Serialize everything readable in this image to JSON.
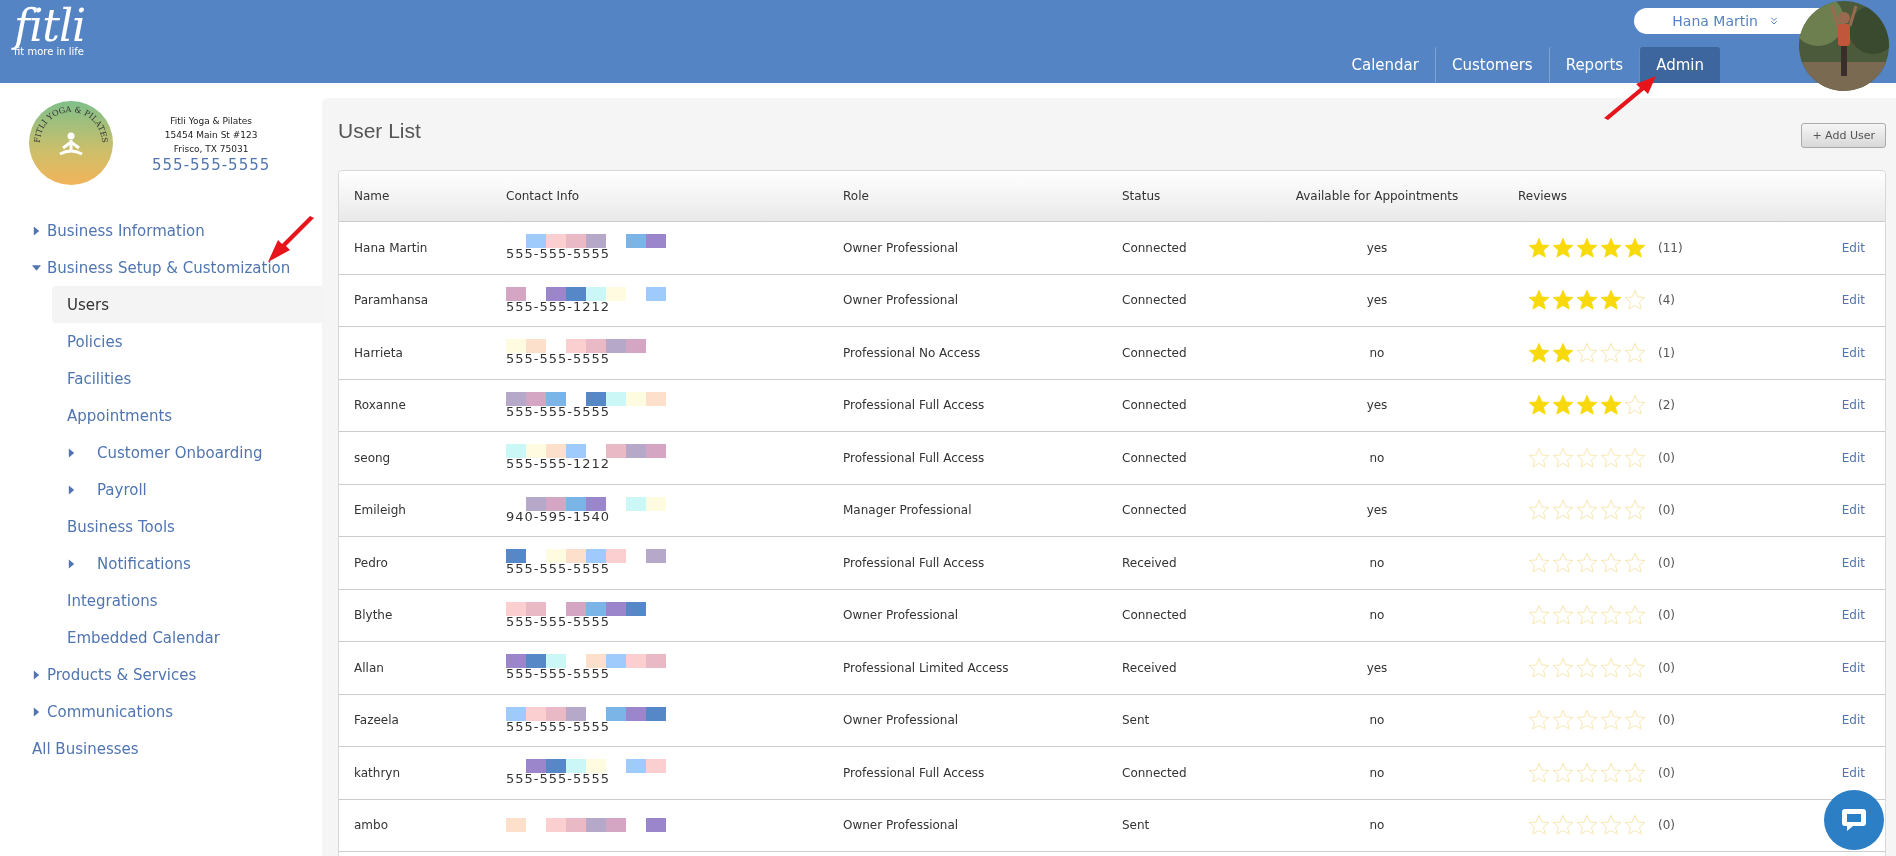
{
  "header": {
    "logo": "fitli",
    "tagline": "fit more in life",
    "user_name": "Hana Martin",
    "nav": [
      {
        "label": "Calendar",
        "selected": false
      },
      {
        "label": "Customers",
        "selected": false
      },
      {
        "label": "Reports",
        "selected": false
      },
      {
        "label": "Admin",
        "selected": true
      }
    ]
  },
  "business": {
    "logo_text": "FITLI YOGA & PILATES",
    "name": "Fitli Yoga & Pilates",
    "address_line_1": "15454 Main St #123",
    "address_line_2": "Frisco, TX 75031",
    "phone": "555-555-5555"
  },
  "sidebar": {
    "items": [
      {
        "label": "Business Information",
        "kind": "group",
        "expanded": false
      },
      {
        "label": "Business Setup & Customization",
        "kind": "group",
        "expanded": true,
        "children": [
          {
            "label": "Users",
            "kind": "link",
            "selected": true
          },
          {
            "label": "Policies",
            "kind": "link",
            "selected": false
          },
          {
            "label": "Facilities",
            "kind": "link",
            "selected": false
          },
          {
            "label": "Appointments",
            "kind": "link",
            "selected": false
          },
          {
            "label": "Customer Onboarding",
            "kind": "group",
            "selected": false
          },
          {
            "label": "Payroll",
            "kind": "group",
            "selected": false
          },
          {
            "label": "Business Tools",
            "kind": "link",
            "selected": false
          },
          {
            "label": "Notifications",
            "kind": "group",
            "selected": false
          },
          {
            "label": "Integrations",
            "kind": "link",
            "selected": false
          },
          {
            "label": "Embedded Calendar",
            "kind": "link",
            "selected": false
          }
        ]
      },
      {
        "label": "Products & Services",
        "kind": "group",
        "expanded": false
      },
      {
        "label": "Communications",
        "kind": "group",
        "expanded": false
      },
      {
        "label": "All Businesses",
        "kind": "link"
      }
    ]
  },
  "page": {
    "title": "User List",
    "add_button": "+ Add User"
  },
  "table": {
    "columns": [
      "Name",
      "Contact Info",
      "Role",
      "Status",
      "Available for Appointments",
      "Reviews"
    ],
    "rows": [
      {
        "name": "Hana Martin",
        "phone": "555-555-5555",
        "role": "Owner Professional",
        "status": "Connected",
        "available": "yes",
        "stars": 5,
        "review_count": "(11)",
        "action": "Edit"
      },
      {
        "name": "Paramhansa",
        "phone": "555-555-1212",
        "role": "Owner Professional",
        "status": "Connected",
        "available": "yes",
        "stars": 4,
        "review_count": "(4)",
        "action": "Edit"
      },
      {
        "name": "Harrieta",
        "phone": "555-555-5555",
        "role": "Professional No Access",
        "status": "Connected",
        "available": "no",
        "stars": 2,
        "review_count": "(1)",
        "action": "Edit"
      },
      {
        "name": "Roxanne",
        "phone": "555-555-5555",
        "role": "Professional Full Access",
        "status": "Connected",
        "available": "yes",
        "stars": 4,
        "review_count": "(2)",
        "action": "Edit"
      },
      {
        "name": "seong",
        "phone": "555-555-1212",
        "role": "Professional Full Access",
        "status": "Connected",
        "available": "no",
        "stars": 0,
        "review_count": "(0)",
        "action": "Edit"
      },
      {
        "name": "Emileigh",
        "phone": "940-595-1540",
        "role": "Manager Professional",
        "status": "Connected",
        "available": "yes",
        "stars": 0,
        "review_count": "(0)",
        "action": "Edit"
      },
      {
        "name": "Pedro",
        "phone": "555-555-5555",
        "role": "Professional Full Access",
        "status": "Received",
        "available": "no",
        "stars": 0,
        "review_count": "(0)",
        "action": "Edit"
      },
      {
        "name": "Blythe",
        "phone": "555-555-5555",
        "role": "Owner Professional",
        "status": "Connected",
        "available": "no",
        "stars": 0,
        "review_count": "(0)",
        "action": "Edit"
      },
      {
        "name": "Allan",
        "phone": "555-555-5555",
        "role": "Professional Limited Access",
        "status": "Received",
        "available": "yes",
        "stars": 0,
        "review_count": "(0)",
        "action": "Edit"
      },
      {
        "name": "Fazeela",
        "phone": "555-555-5555",
        "role": "Owner Professional",
        "status": "Sent",
        "available": "no",
        "stars": 0,
        "review_count": "(0)",
        "action": "Edit"
      },
      {
        "name": "kathryn",
        "phone": "555-555-5555",
        "role": "Professional Full Access",
        "status": "Connected",
        "available": "no",
        "stars": 0,
        "review_count": "(0)",
        "action": "Edit"
      },
      {
        "name": "ambo",
        "role": "Owner Professional",
        "status": "Sent",
        "available": "no",
        "stars": 0,
        "review_count": "(0)"
      }
    ]
  }
}
